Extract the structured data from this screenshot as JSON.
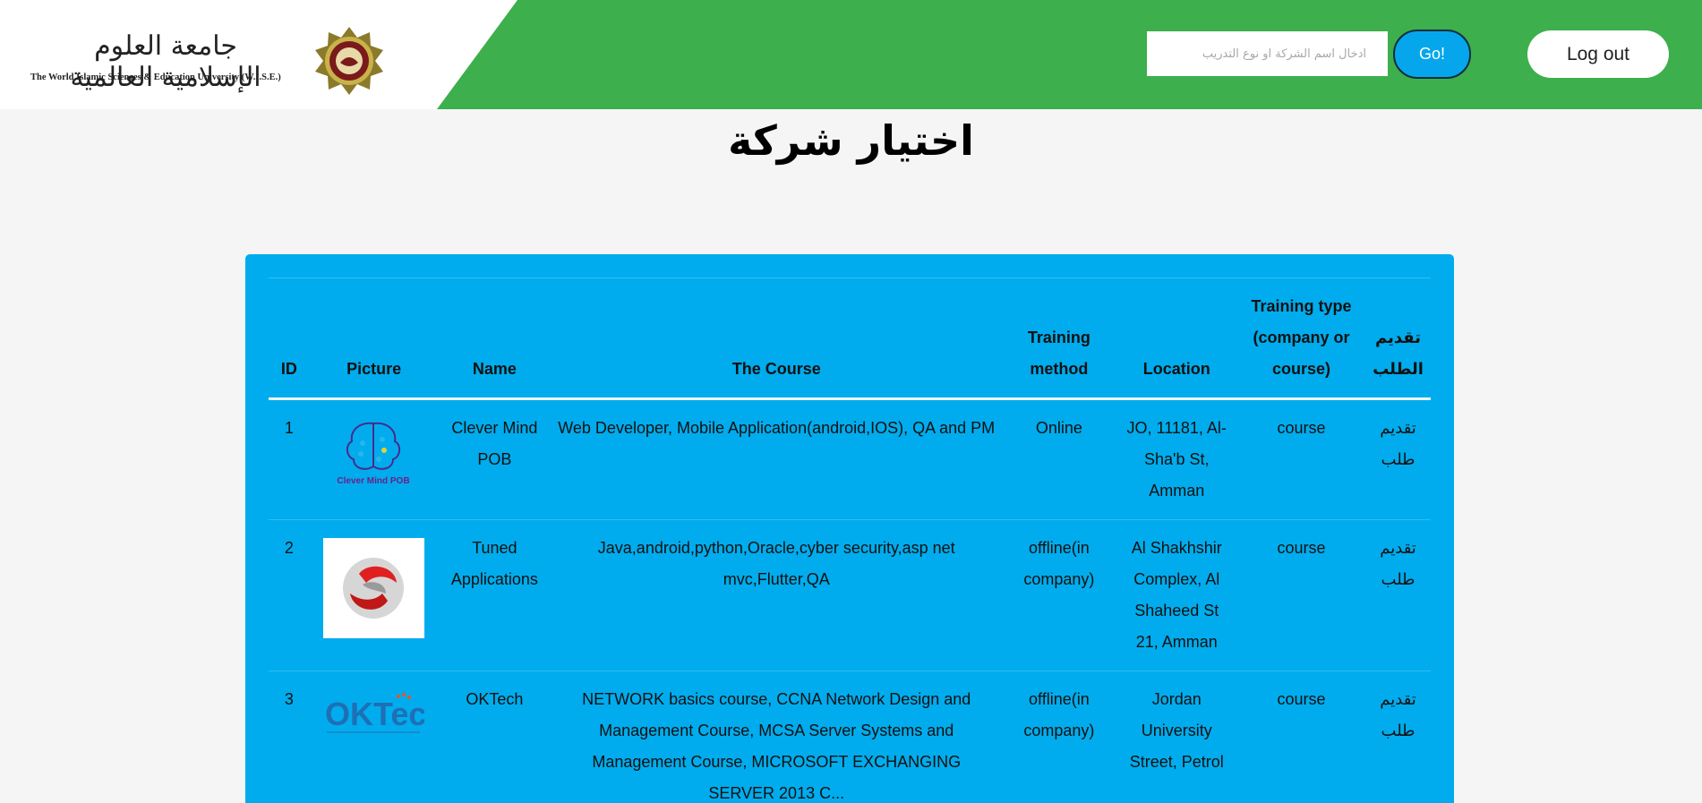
{
  "header": {
    "logo_arabic": "جامعة العلوم الإسلامية العالمية",
    "logo_english": "The World Islamic Sciences & Education University (W.I.S.E.)",
    "search_placeholder": "ادخال اسم الشركة او نوع التدريب",
    "go_label": "Go!",
    "logout_label": "Log out"
  },
  "page": {
    "title": "اختيار شركة"
  },
  "table": {
    "headers": {
      "id": "ID",
      "picture": "Picture",
      "name": "Name",
      "course": "The Course",
      "method": "Training method",
      "location": "Location",
      "type": "Training type (company or course)",
      "apply": "تقديم الطلب"
    },
    "rows": [
      {
        "id": "1",
        "logo_text": "Clever Mind POB",
        "name": "Clever Mind POB",
        "course": "Web Developer, Mobile Application(android,IOS), QA and PM",
        "method": "Online",
        "location": "JO, 11181, Al-Sha'b St, Amman",
        "type": "course",
        "apply": "تقديم طلب"
      },
      {
        "id": "2",
        "name": "Tuned Applications",
        "course": "Java,android,python,Oracle,cyber security,asp net mvc,Flutter,QA",
        "method": "offline(in company)",
        "location": "Al Shakhshir Complex, Al Shaheed St 21, Amman",
        "type": "course",
        "apply": "تقديم طلب"
      },
      {
        "id": "3",
        "logo_text": "OKTech",
        "name": "OKTech",
        "course": "NETWORK basics course, CCNA Network Design and Management Course, MCSA Server Systems and Management Course, MICROSOFT EXCHANGING SERVER 2013 C...",
        "method": "offline(in company)",
        "location": "Jordan University Street, Petrol",
        "type": "course",
        "apply": "تقديم طلب"
      }
    ]
  },
  "colors": {
    "header_green": "#3daf4c",
    "panel_blue": "#00aced",
    "go_blue": "#05a6ec"
  }
}
